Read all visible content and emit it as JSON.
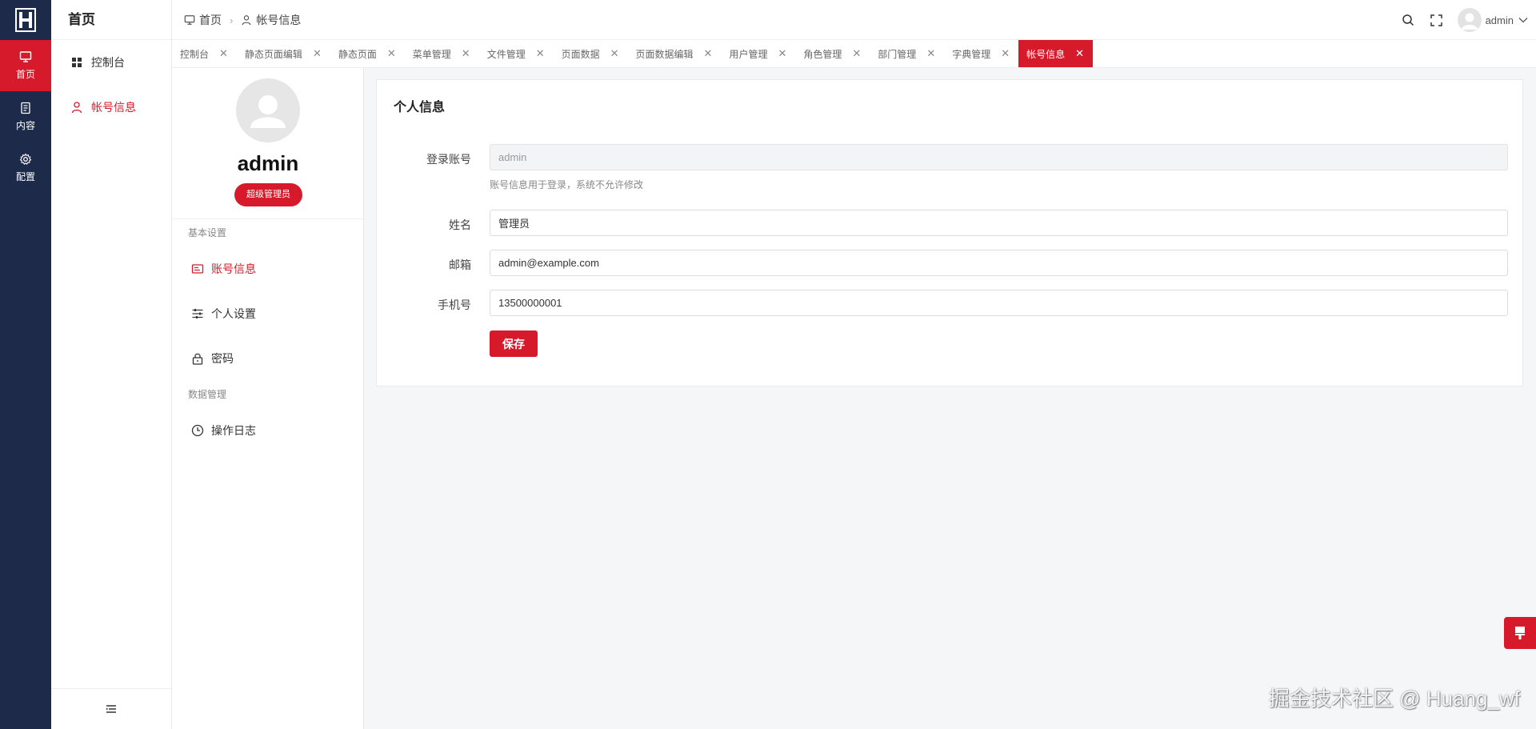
{
  "rail": {
    "items": [
      {
        "label": "首页",
        "icon": "monitor-icon"
      },
      {
        "label": "内容",
        "icon": "document-icon"
      },
      {
        "label": "配置",
        "icon": "gear-icon"
      }
    ]
  },
  "menu": {
    "title": "首页",
    "items": [
      {
        "label": "控制台",
        "icon": "dashboard-grid-icon"
      },
      {
        "label": "帐号信息",
        "icon": "user-icon"
      }
    ]
  },
  "header": {
    "breadcrumb": [
      {
        "label": "首页",
        "icon": "monitor-icon"
      },
      {
        "label": "帐号信息",
        "icon": "user-icon"
      }
    ],
    "username": "admin"
  },
  "tabs": [
    {
      "label": "控制台"
    },
    {
      "label": "静态页面编辑"
    },
    {
      "label": "静态页面"
    },
    {
      "label": "菜单管理"
    },
    {
      "label": "文件管理"
    },
    {
      "label": "页面数据"
    },
    {
      "label": "页面数据编辑"
    },
    {
      "label": "用户管理"
    },
    {
      "label": "角色管理"
    },
    {
      "label": "部门管理"
    },
    {
      "label": "字典管理"
    },
    {
      "label": "帐号信息"
    }
  ],
  "profile": {
    "name": "admin",
    "role": "超级管理员",
    "groups": [
      {
        "title": "基本设置",
        "items": [
          {
            "label": "账号信息",
            "icon": "id-card-icon"
          },
          {
            "label": "个人设置",
            "icon": "sliders-icon"
          },
          {
            "label": "密码",
            "icon": "lock-icon"
          }
        ]
      },
      {
        "title": "数据管理",
        "items": [
          {
            "label": "操作日志",
            "icon": "clock-icon"
          }
        ]
      }
    ]
  },
  "form": {
    "title": "个人信息",
    "login_label": "登录账号",
    "login_value": "admin",
    "login_help": "账号信息用于登录，系统不允许修改",
    "name_label": "姓名",
    "name_value": "管理员",
    "email_label": "邮箱",
    "email_value": "admin@example.com",
    "phone_label": "手机号",
    "phone_value": "13500000001",
    "save_label": "保存"
  },
  "watermark": "掘金技术社区 @ Huang_wf",
  "colors": {
    "accent": "#d71a2b",
    "rail_bg": "#1e2a4a",
    "page_bg": "#f5f6f8"
  }
}
